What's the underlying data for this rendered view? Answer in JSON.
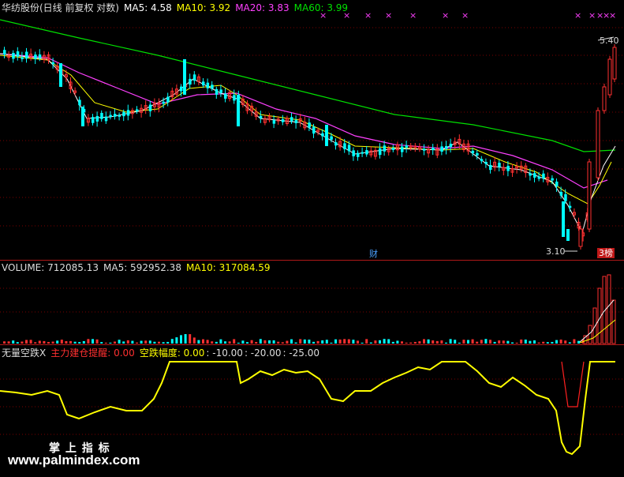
{
  "main": {
    "name_label": "华纺股份(日线 前复权 对数)",
    "ma5_label": "MA5: 4.58",
    "ma10_label": "MA10: 3.92",
    "ma20_label": "MA20: 3.83",
    "ma60_label": "MA60: 3.99",
    "high_label": "5.40",
    "low_label": "3.10",
    "fin_marker": "财",
    "board_badge": "3榜",
    "signal_glyph": "×",
    "colors": {
      "ma5": "#ffffff",
      "ma10": "#ffff00",
      "ma20": "#ff40ff",
      "ma60": "#00e000",
      "up": "#ff3030",
      "down": "#00ffff"
    }
  },
  "volume": {
    "volume_label": "VOLUME: 712085.13",
    "ma5_label": "MA5: 592952.38",
    "ma10_label": "MA10: 317084.59"
  },
  "indicator": {
    "name_label": "无量空跌X",
    "alert_label": "主力建仓提醒: 0.00",
    "range_label": "空跌幅度: 0.00",
    "level1": ": -10.00",
    "level2": ": -20.00",
    "level3": ": -25.00"
  },
  "watermark": {
    "title": "掌 上 指 标",
    "url": "www.palmindex.com"
  }
}
